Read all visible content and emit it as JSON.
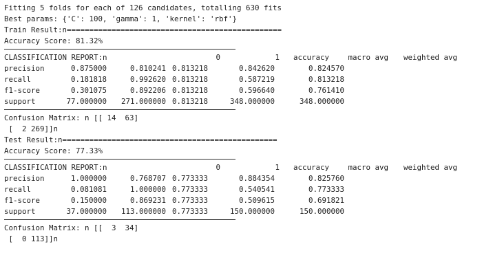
{
  "header": {
    "fitting": "Fitting 5 folds for each of 126 candidates, totalling 630 fits",
    "best_params": "Best params: {'C': 100, 'gamma': 1, 'kernel': 'rbf'}"
  },
  "train": {
    "title": "Train Result:n================================================",
    "accuracy": "Accuracy Score: 81.32%",
    "report": {
      "header": [
        "CLASSIFICATION REPORT:n",
        "0",
        "1",
        "accuracy",
        "macro avg",
        "weighted avg"
      ],
      "rows": [
        [
          "precision",
          "0.875000",
          "0.810241",
          "0.813218",
          "0.842620",
          "0.824570"
        ],
        [
          "recall",
          "0.181818",
          "0.992620",
          "0.813218",
          "0.587219",
          "0.813218"
        ],
        [
          "f1-score",
          "0.301075",
          "0.892206",
          "0.813218",
          "0.596640",
          "0.761410"
        ],
        [
          "support",
          "77.000000",
          "271.000000",
          "0.813218",
          "348.000000",
          "348.000000"
        ]
      ]
    },
    "confusion_line1": "Confusion Matrix: n [[ 14  63]",
    "confusion_line2": " [  2 269]]n"
  },
  "test": {
    "title": "Test Result:n================================================",
    "accuracy": "Accuracy Score: 77.33%",
    "report": {
      "header": [
        "CLASSIFICATION REPORT:n",
        "0",
        "1",
        "accuracy",
        "macro avg",
        "weighted avg"
      ],
      "rows": [
        [
          "precision",
          "1.000000",
          "0.768707",
          "0.773333",
          "0.884354",
          "0.825760"
        ],
        [
          "recall",
          "0.081081",
          "1.000000",
          "0.773333",
          "0.540541",
          "0.773333"
        ],
        [
          "f1-score",
          "0.150000",
          "0.869231",
          "0.773333",
          "0.509615",
          "0.691821"
        ],
        [
          "support",
          "37.000000",
          "113.000000",
          "0.773333",
          "150.000000",
          "150.000000"
        ]
      ]
    },
    "confusion_line1": "Confusion Matrix: n [[  3  34]",
    "confusion_line2": " [  0 113]]n"
  }
}
